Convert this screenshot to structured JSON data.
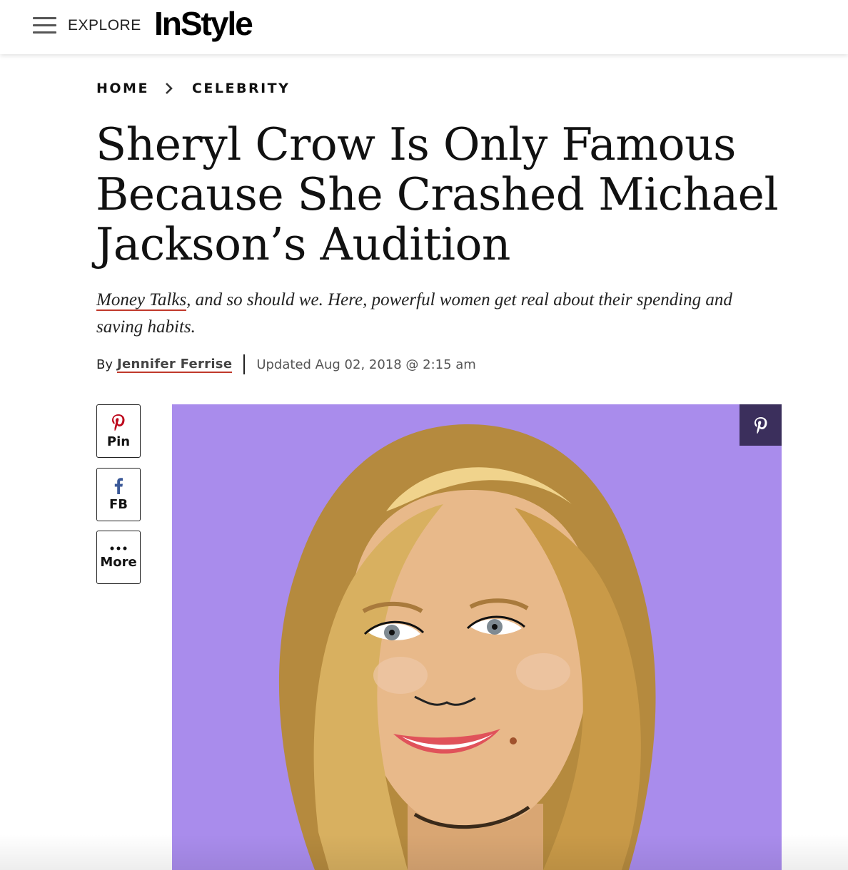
{
  "header": {
    "menu_label": "EXPLORE",
    "logo": "InStyle"
  },
  "breadcrumb": {
    "items": [
      "HOME",
      "CELEBRITY"
    ]
  },
  "article": {
    "headline": "Sheryl Crow Is Only Famous Because She Crashed Michael Jackson’s Audition",
    "dek_link": "Money Talks",
    "dek_rest": ", and so should we. Here, powerful women get real about their spending and saving habits.",
    "byline_prefix": "By",
    "author": "Jennifer Ferrise",
    "updated": "Updated Aug 02, 2018 @ 2:15 am"
  },
  "share": {
    "pin_label": "Pin",
    "fb_label": "FB",
    "more_label": "More"
  },
  "colors": {
    "accent_red": "#c0392b",
    "pinterest": "#bd081c",
    "facebook": "#3b5998",
    "hero_bg": "#a98cec",
    "pin_overlay": "#3b2f5c"
  },
  "icons": [
    "hamburger-icon",
    "chevron-right-icon",
    "pinterest-icon",
    "facebook-icon",
    "more-dots-icon"
  ]
}
